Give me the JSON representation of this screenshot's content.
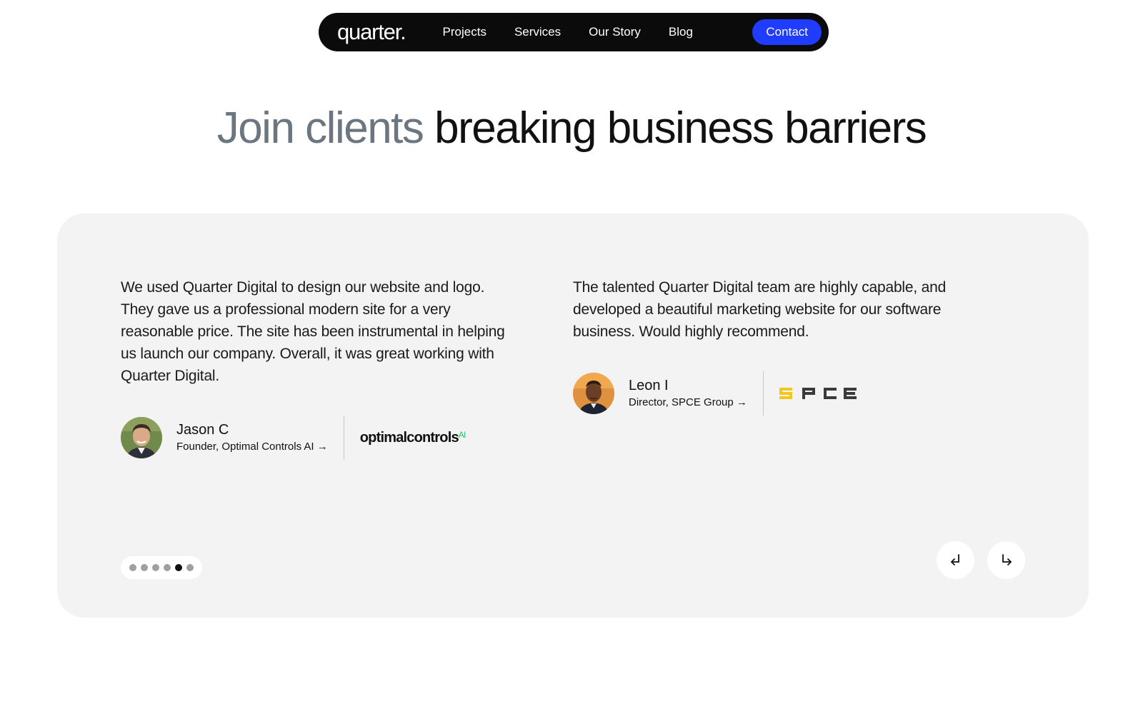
{
  "nav": {
    "logo": "quarter.",
    "links": [
      {
        "label": "Projects"
      },
      {
        "label": "Services"
      },
      {
        "label": "Our Story"
      },
      {
        "label": "Blog"
      }
    ],
    "contact_label": "Contact"
  },
  "hero": {
    "heading_muted": "Join clients",
    "heading_strong": "breaking business barriers"
  },
  "testimonials": [
    {
      "quote": "We used Quarter Digital to design our website and logo. They gave us a professional modern site for a very reasonable price. The site has been instrumental in helping us launch our company. Overall, it was great working with Quarter Digital.",
      "name": "Jason C",
      "role": "Founder, Optimal Controls AI →",
      "company_logo_text": "optimalcontrols",
      "company_logo_suffix": "AI"
    },
    {
      "quote": "The talented Quarter Digital team are highly capable, and developed a beautiful marketing website for our software business. Would highly recommend.",
      "name": "Leon I",
      "role": "Director, SPCE Group →",
      "company_logo_text": "SPCE"
    }
  ],
  "carousel": {
    "dot_count": 6,
    "active_index": 4
  },
  "colors": {
    "nav_bg": "#0b0b0b",
    "accent": "#1f3cff",
    "card_bg": "#f3f3f3",
    "muted_heading": "#6b7681",
    "spce_yellow": "#f2c81e",
    "optimal_ai_green": "#2bbf6a"
  },
  "icons": {
    "prev": "arrow-return-left-icon",
    "next": "arrow-return-right-icon"
  }
}
